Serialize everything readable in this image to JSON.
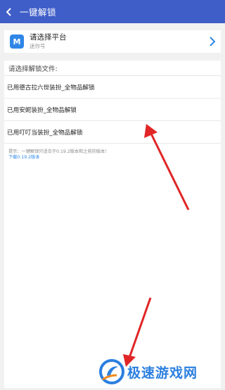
{
  "header": {
    "title": "一键解锁",
    "background": "#3f5ec8"
  },
  "platform": {
    "icon_letter": "M",
    "title": "请选择平台",
    "subtitle": "迷你号"
  },
  "files": {
    "header": "请选择解锁文件:",
    "items": [
      {
        "label": "已用德古拉六世装扮_全物品解锁"
      },
      {
        "label": "已用安妮装扮_全物品解锁"
      },
      {
        "label": "已用叮叮当装扮_全物品解锁"
      }
    ]
  },
  "notice": {
    "text": "提示：一键解锁只适合于0.19.2版本和之前的版本！",
    "link": "下载0.19.2版本"
  },
  "watermark": {
    "text": "极速游戏网"
  },
  "colors": {
    "accent": "#2f86e6",
    "annotation_arrow": "#e02626"
  }
}
